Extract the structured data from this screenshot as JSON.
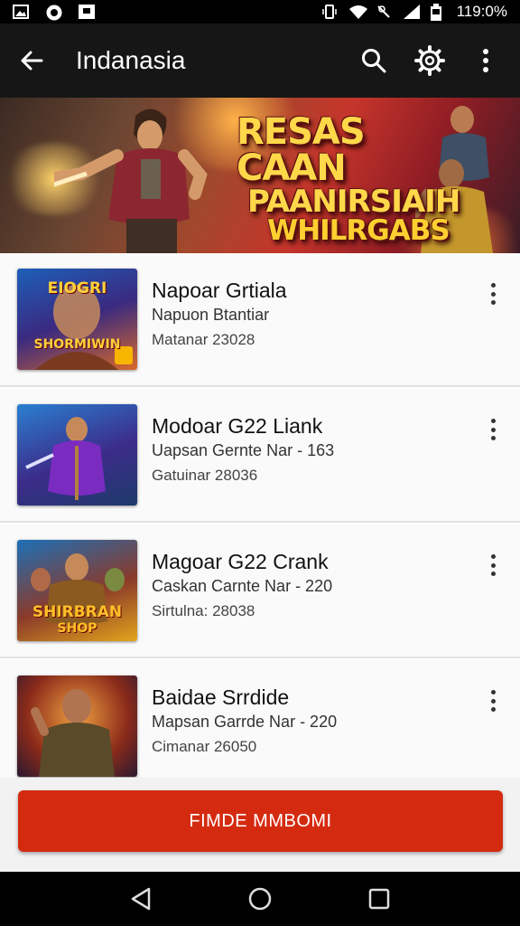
{
  "status_bar": {
    "time": "119:0%",
    "icons": [
      "image-icon",
      "whatsapp-icon",
      "tv-icon",
      "vibrate-icon",
      "wifi-icon",
      "mute-icon",
      "signal-icon",
      "battery-icon"
    ]
  },
  "app_bar": {
    "title": "Indanasia",
    "back_icon": "back-arrow-icon",
    "actions": [
      "search-icon",
      "settings-icon",
      "more-vert-icon"
    ]
  },
  "banner": {
    "lines": [
      "RESAS CAAN",
      "PAANIRSIAIH",
      "WHILRGABS"
    ]
  },
  "list": {
    "items": [
      {
        "title": "Napoar Grtiala",
        "subtitle": "Napuon Btantiar",
        "meta": "Matanar 23028",
        "thumb_text": "EIOGRI",
        "thumb_text2": "SHORMIWIN",
        "accent": "#f7b500"
      },
      {
        "title": "Modoar G22 Liank",
        "subtitle": "Uapsan Gernte Nar - 163",
        "meta": "Gatuinar 28036",
        "thumb_text": "",
        "thumb_text2": "",
        "accent": "#7a2bc0"
      },
      {
        "title": "Magoar G22 Crank",
        "subtitle": "Caskan Carnte Nar - 220",
        "meta": "Sirtulna: 28038",
        "thumb_text": "SHIRBRAN",
        "thumb_text2": "SHOP",
        "accent": "#e2a51c"
      },
      {
        "title": "Baidae Srrdide",
        "subtitle": "Mapsan Garrde Nar - 220",
        "meta": "Cimanar 26050",
        "thumb_text": "",
        "thumb_text2": "",
        "accent": "#c8501c"
      }
    ]
  },
  "cta": {
    "label": "FIMDE MMBOMI"
  },
  "nav": {
    "buttons": [
      "back-triangle-icon",
      "home-circle-icon",
      "recents-square-icon"
    ]
  },
  "colors": {
    "accent": "#d42b10",
    "appbar": "#161616"
  }
}
